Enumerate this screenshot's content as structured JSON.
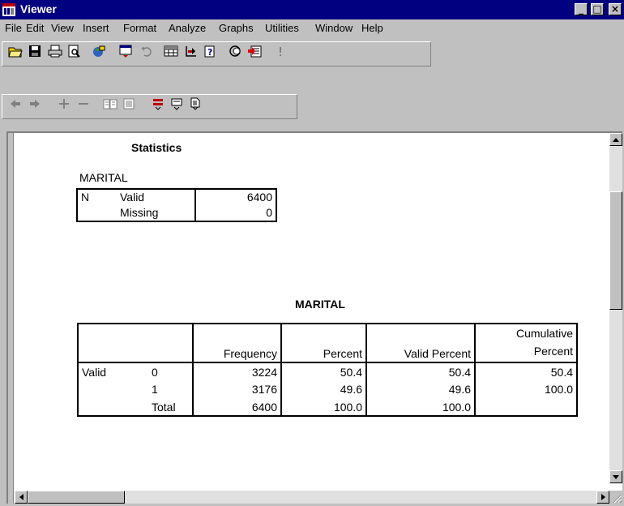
{
  "window": {
    "title": "Viewer",
    "controls": [
      "_",
      "□",
      "×"
    ]
  },
  "menu": [
    "File",
    "Edit",
    "View",
    "Insert",
    "Format",
    "Analyze",
    "Graphs",
    "Utilities",
    "Window",
    "Help"
  ],
  "toolbar1": {
    "icons": [
      "open-icon",
      "save-icon",
      "print-icon",
      "print-preview-icon",
      "export-icon",
      "dialog-recall-icon",
      "undo-icon",
      "goto-data-icon",
      "goto-case-icon",
      "variables-icon",
      "use-sets-icon",
      "designate-window-icon",
      "run-icon"
    ]
  },
  "toolbar2": {
    "icons": [
      "promote-icon",
      "demote-icon",
      "expand-icon",
      "collapse-icon",
      "show-icon",
      "hide-icon",
      "insert-heading-icon",
      "insert-title-icon",
      "insert-text-icon"
    ]
  },
  "output": {
    "statistics_title": "Statistics",
    "statistics_var": "MARITAL",
    "statistics_rows": [
      {
        "c1": "N",
        "c2": "Valid",
        "value": "6400"
      },
      {
        "c1": "",
        "c2": "Missing",
        "value": "0"
      }
    ],
    "freq_title": "MARITAL",
    "freq_headers": [
      "",
      "",
      "Frequency",
      "Percent",
      "Valid Percent",
      "Cumulative Percent"
    ],
    "freq_rows": [
      {
        "c1": "Valid",
        "c2": "0",
        "freq": "3224",
        "pct": "50.4",
        "vpct": "50.4",
        "cpct": "50.4"
      },
      {
        "c1": "",
        "c2": "1",
        "freq": "3176",
        "pct": "49.6",
        "vpct": "49.6",
        "cpct": "100.0"
      },
      {
        "c1": "",
        "c2": "Total",
        "freq": "6400",
        "pct": "100.0",
        "vpct": "100.0",
        "cpct": ""
      }
    ]
  }
}
